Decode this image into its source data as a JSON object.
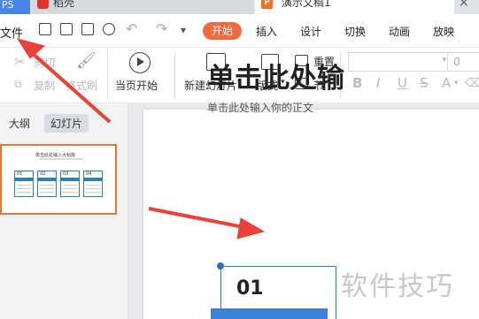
{
  "tabs": {
    "ps_label": "PS",
    "draw_label": "稻壳",
    "doc_label": "演示文稿1",
    "close_symbol": "×"
  },
  "menu": {
    "file": "文件",
    "undo_symbol": "↶",
    "redo_symbol": "↷",
    "dropdown_symbol": "▾",
    "items": [
      "开始",
      "插入",
      "设计",
      "切换",
      "动画",
      "放映"
    ]
  },
  "ribbon": {
    "cut": "剪切",
    "copy": "复制",
    "format_painter": "格式刷",
    "from_current": "当页开始",
    "new_slide": "新建幻灯片",
    "layout": "版式",
    "reset": "重置",
    "section": "节",
    "font_size": "0",
    "format_buttons": [
      "B",
      "I",
      "U",
      "S",
      "A"
    ]
  },
  "left_panel": {
    "tab_outline": "大纲",
    "tab_slides": "幻灯片",
    "thumbnail": {
      "number": "1",
      "title": "单击此处输入大标题",
      "cards": [
        "01",
        "02",
        "03",
        "04"
      ]
    }
  },
  "slide": {
    "title": "单击此处输",
    "subtitle": "单击此处输入你的正文",
    "card_number": "01"
  },
  "watermark": "软件技巧",
  "colors": {
    "accent": "#f26a3f",
    "arrow": "#e8423a",
    "card_border": "#2f7fb6",
    "card_bar": "#3b82d8"
  }
}
